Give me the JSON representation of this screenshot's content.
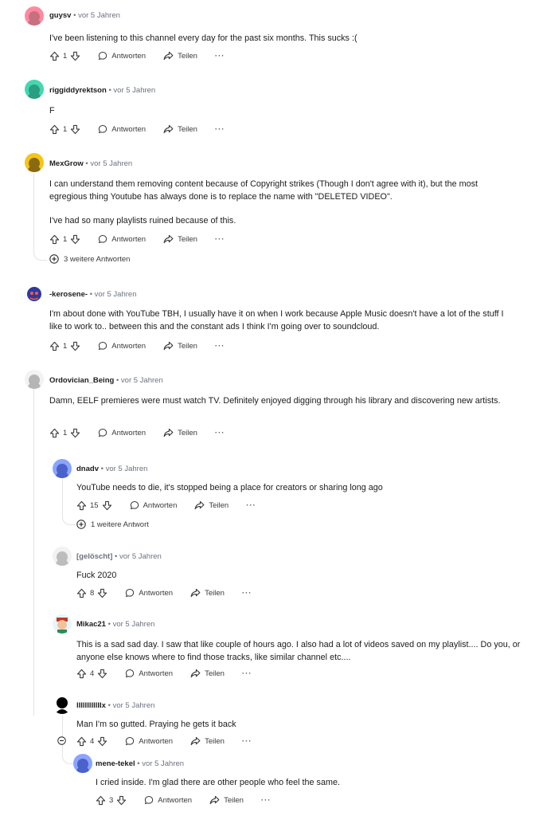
{
  "labels": {
    "reply": "Antworten",
    "share": "Teilen",
    "more": "···"
  },
  "comments": [
    {
      "author": "guysv",
      "sep": "•",
      "time": "vor 5 Jahren",
      "text": [
        "I've been listening to this channel every day for the past six months. This sucks :("
      ],
      "votes": "1"
    },
    {
      "author": "riggiddyrektson",
      "sep": "•",
      "time": "vor 5 Jahren",
      "text": [
        "F"
      ],
      "votes": "1"
    },
    {
      "author": "MexGrow",
      "sep": "•",
      "time": "vor 5 Jahren",
      "text": [
        "I can understand them removing content because of Copyright strikes (Though I don't agree with it), but the most egregious thing Youtube has always done is to replace the name with \"DELETED VIDEO\".",
        "I've had so many playlists ruined because of this."
      ],
      "votes": "1",
      "more_replies": "3 weitere Antworten"
    },
    {
      "author": "-kerosene-",
      "sep": "•",
      "time": "vor 5 Jahren",
      "text": [
        "I'm about done with YouTube TBH, I usually have it on when I work because Apple Music doesn't have a lot of the stuff I like to work to.. between this and the constant ads I think I'm going over to soundcloud."
      ],
      "votes": "1"
    },
    {
      "author": "Ordovician_Being",
      "sep": "•",
      "time": "vor 5 Jahren",
      "text": [
        "Damn, EELF premieres were must watch TV. Definitely enjoyed digging through his library and discovering new artists."
      ],
      "votes": "1"
    },
    {
      "author": "dnadv",
      "sep": "•",
      "time": "vor 5 Jahren",
      "text": [
        "YouTube needs to die, it's stopped being a place for creators or sharing long ago"
      ],
      "votes": "15",
      "more_replies": "1 weitere Antwort"
    },
    {
      "author": "[gelöscht]",
      "sep": "•",
      "time": "vor 5 Jahren",
      "text": [
        "Fuck 2020"
      ],
      "votes": "8"
    },
    {
      "author": "Mikac21",
      "sep": "•",
      "time": "vor 5 Jahren",
      "text": [
        "This is a sad sad day. I saw that like couple of hours ago. I also had a lot of videos saved on my playlist.... Do you, or anyone else knows where to find those tracks, like similar channel etc...."
      ],
      "votes": "4"
    },
    {
      "author": "lIIlIIlIIlIIx",
      "sep": "•",
      "time": "vor 5 Jahren",
      "text": [
        "Man I'm so gutted. Praying he gets it back"
      ],
      "votes": "4"
    },
    {
      "author": "mene-tekel",
      "sep": "•",
      "time": "vor 5 Jahren",
      "text": [
        "I cried inside. I'm glad there are other people who feel the same."
      ],
      "votes": "3"
    }
  ]
}
